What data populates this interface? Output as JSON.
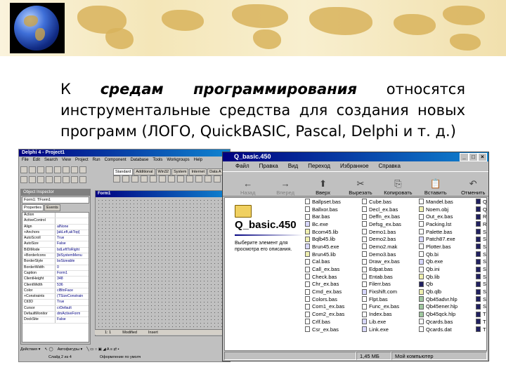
{
  "slide": {
    "text_prefix": "К ",
    "text_emphasis": "средам программирования",
    "text_suffix": " относятся инструментальные средства для создания новых программ (ЛОГО, QuickBASIC, Pascal, Delphi и т. д.)"
  },
  "delphi": {
    "title": "Delphi 4 - Project1",
    "menu": [
      "File",
      "Edit",
      "Search",
      "View",
      "Project",
      "Run",
      "Component",
      "Database",
      "Tools",
      "Workgroups",
      "Help"
    ],
    "palette_tabs": [
      "Standard",
      "Additional",
      "Win32",
      "System",
      "Internet",
      "Data A"
    ],
    "inspector": {
      "title": "Object Inspector",
      "combo": "Form1: TForm1",
      "tabs": [
        "Properties",
        "Events"
      ],
      "props": [
        [
          "Action",
          ""
        ],
        [
          "ActiveControl",
          ""
        ],
        [
          "Align",
          "alNone"
        ],
        [
          "+Anchors",
          "[akLeft,akTop]"
        ],
        [
          "AutoScroll",
          "True"
        ],
        [
          "AutoSize",
          "False"
        ],
        [
          "BiDiMode",
          "bdLeftToRight"
        ],
        [
          "+BorderIcons",
          "[biSystemMenu"
        ],
        [
          "BorderStyle",
          "bsSizeable"
        ],
        [
          "BorderWidth",
          "0"
        ],
        [
          "Caption",
          "Form1"
        ],
        [
          "ClientHeight",
          "348"
        ],
        [
          "ClientWidth",
          "536"
        ],
        [
          "Color",
          "clBtnFace"
        ],
        [
          "+Constraints",
          "(TSizeConstrain"
        ],
        [
          "Ctl3D",
          "True"
        ],
        [
          "Cursor",
          "crDefault"
        ],
        [
          "DefaultMonitor",
          "dmActiveForm"
        ],
        [
          "DockSite",
          "False"
        ]
      ]
    },
    "form_title": "Form1",
    "editor_status": [
      "1: 1",
      "Modified",
      "Insert"
    ],
    "draw_bar": [
      "Действия ▾",
      "Автофигуры ▾"
    ],
    "status_bar": [
      "Слайд 2 из 4",
      "Оформление по умолч"
    ]
  },
  "explorer": {
    "title": "Q_basic.450",
    "menu": [
      "Файл",
      "Правка",
      "Вид",
      "Переход",
      "Избранное",
      "Справка"
    ],
    "toolbar": [
      {
        "label": "Назад",
        "icon": "←",
        "enabled": false
      },
      {
        "label": "Вперед",
        "icon": "→",
        "enabled": false
      },
      {
        "label": "Вверх",
        "icon": "⬆",
        "enabled": true
      },
      {
        "label": "Вырезать",
        "icon": "✂",
        "enabled": true
      },
      {
        "label": "Копировать",
        "icon": "⎘",
        "enabled": true
      },
      {
        "label": "Вставить",
        "icon": "📋",
        "enabled": true
      },
      {
        "label": "Отменить",
        "icon": "↶",
        "enabled": true
      }
    ],
    "folder_name": "Q_basic.450",
    "hint": "Выберите элемент для просмотра его описания.",
    "columns": [
      [
        "Ballpset.bas",
        "Ballxor.bas",
        "Bar.bas",
        "Bc.exe",
        "Bcom45.lib",
        "Bqlb45.lib",
        "Brun45.exe",
        "Brun45.lib",
        "Cal.bas",
        "Call_ex.bas",
        "Check.bas",
        "Chr_ex.bas",
        "Cmd_ex.bas",
        "Colors.bas",
        "Com1_ex.bas",
        "Com2_ex.bas",
        "Crlf.bas",
        "Csr_ex.bas"
      ],
      [
        "Cube.bas",
        "Decl_ex.bas",
        "Deffn_ex.bas",
        "Defsg_ex.bas",
        "Demo1.bas",
        "Demo2.bas",
        "Demo2.mak",
        "Demo3.bas",
        "Draw_ex.bas",
        "Edpat.bas",
        "Entab.bas",
        "Filerr.bas",
        "Fixshift.com",
        "Flpt.bas",
        "Func_ex.bas",
        "Index.bas",
        "Lib.exe",
        "Link.exe"
      ],
      [
        "Mandel.bas",
        "Noem.obj",
        "Out_ex.bas",
        "Packing.lst",
        "Palette.bas",
        "Patch87.exe",
        "Plotter.bas",
        "Qb.bi",
        "Qb.exe",
        "Qb.ini",
        "Qb.lib",
        "Qb",
        "Qb.qlb",
        "Qb45advr.hlp",
        "Qb45ener.hlp",
        "Qb45qck.hlp",
        "Qcards.bas",
        "Qcards.dat"
      ],
      [
        "Q",
        "Q",
        "R",
        "R",
        "S",
        "S",
        "S",
        "S",
        "S",
        "S",
        "S",
        "S",
        "S",
        "S",
        "S",
        "T",
        "T",
        "T"
      ]
    ],
    "status": [
      "",
      "1,45 МБ",
      "Мой компьютер"
    ]
  }
}
